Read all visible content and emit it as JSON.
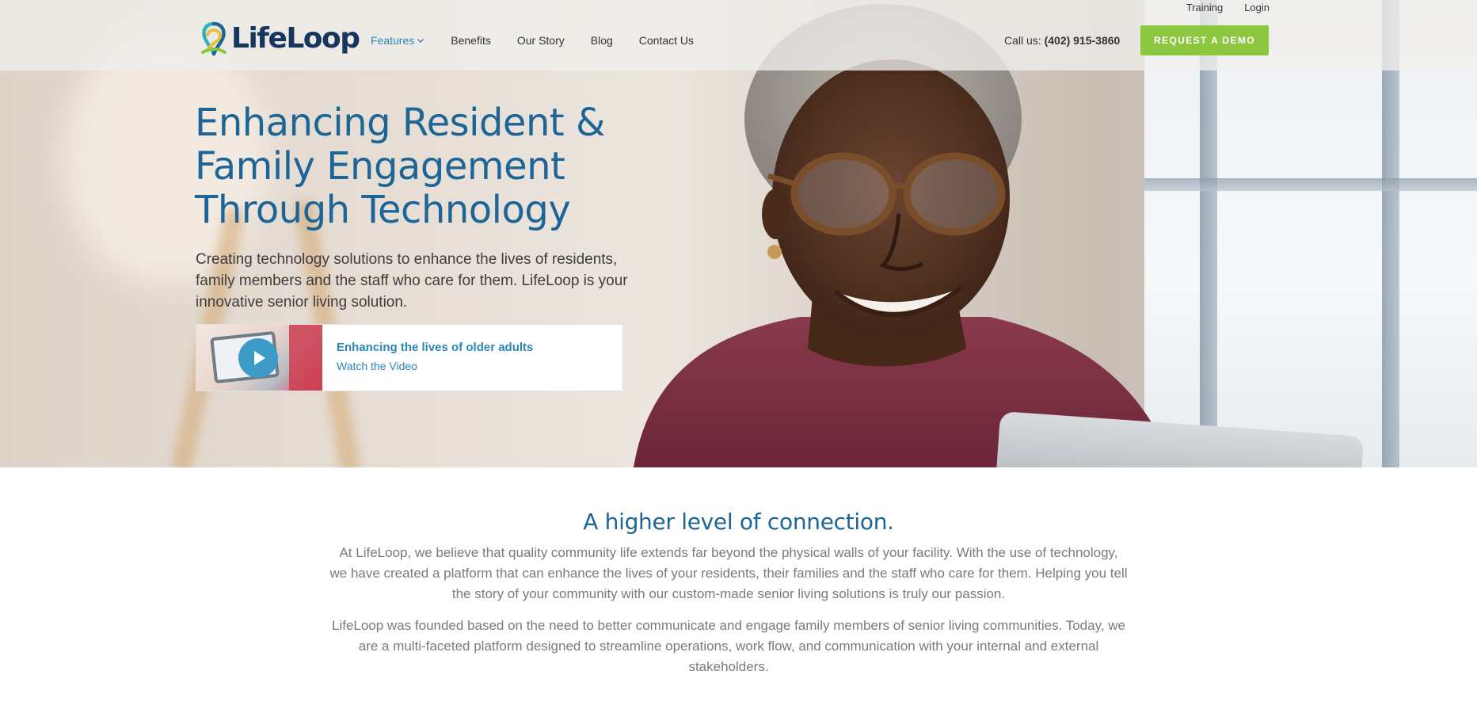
{
  "utility_nav": {
    "training": "Training",
    "login": "Login"
  },
  "brand": {
    "name": "LifeLoop",
    "colors": {
      "navy": "#17365d",
      "blue": "#1d6596",
      "link": "#2a86b8",
      "green": "#8dc63f",
      "teal": "#2fb0c2",
      "yellow": "#e6c23a"
    }
  },
  "main_nav": {
    "items": [
      {
        "label": "Features",
        "has_dropdown": true,
        "active": true
      },
      {
        "label": "Benefits"
      },
      {
        "label": "Our Story"
      },
      {
        "label": "Blog"
      },
      {
        "label": "Contact Us"
      }
    ],
    "dropdown_icon": "chevron-down-icon"
  },
  "contact": {
    "prefix": "Call us:",
    "phone": "(402) 915-3860"
  },
  "cta": {
    "label": "REQUEST A DEMO"
  },
  "hero": {
    "title_lines": [
      "Enhancing Resident &",
      "Family Engagement",
      "Through Technology"
    ],
    "subtitle_lines": [
      "Creating technology solutions to enhance the lives of residents,",
      "family members and the staff who care for them. LifeLoop is your",
      "innovative senior living solution."
    ],
    "video_card": {
      "title": "Enhancing the lives of older adults",
      "link": "Watch the Video",
      "icon": "play-icon"
    }
  },
  "connection": {
    "title": "A higher level of connection.",
    "paragraph_1_lines": [
      "At LifeLoop, we believe that quality community life extends far beyond the physical walls of your facility. With the use of technology,",
      "we have created a platform that can enhance the lives of your residents, their families and the staff who care for them. Helping you tell",
      "the story of your community with our custom-made senior living solutions is truly our passion."
    ],
    "paragraph_2_lines": [
      "LifeLoop was founded based on the need to better communicate and engage family members of senior living communities. Today, we",
      "are a multi-faceted platform designed to streamline operations, work flow, and communication with your internal and external",
      "stakeholders."
    ]
  }
}
